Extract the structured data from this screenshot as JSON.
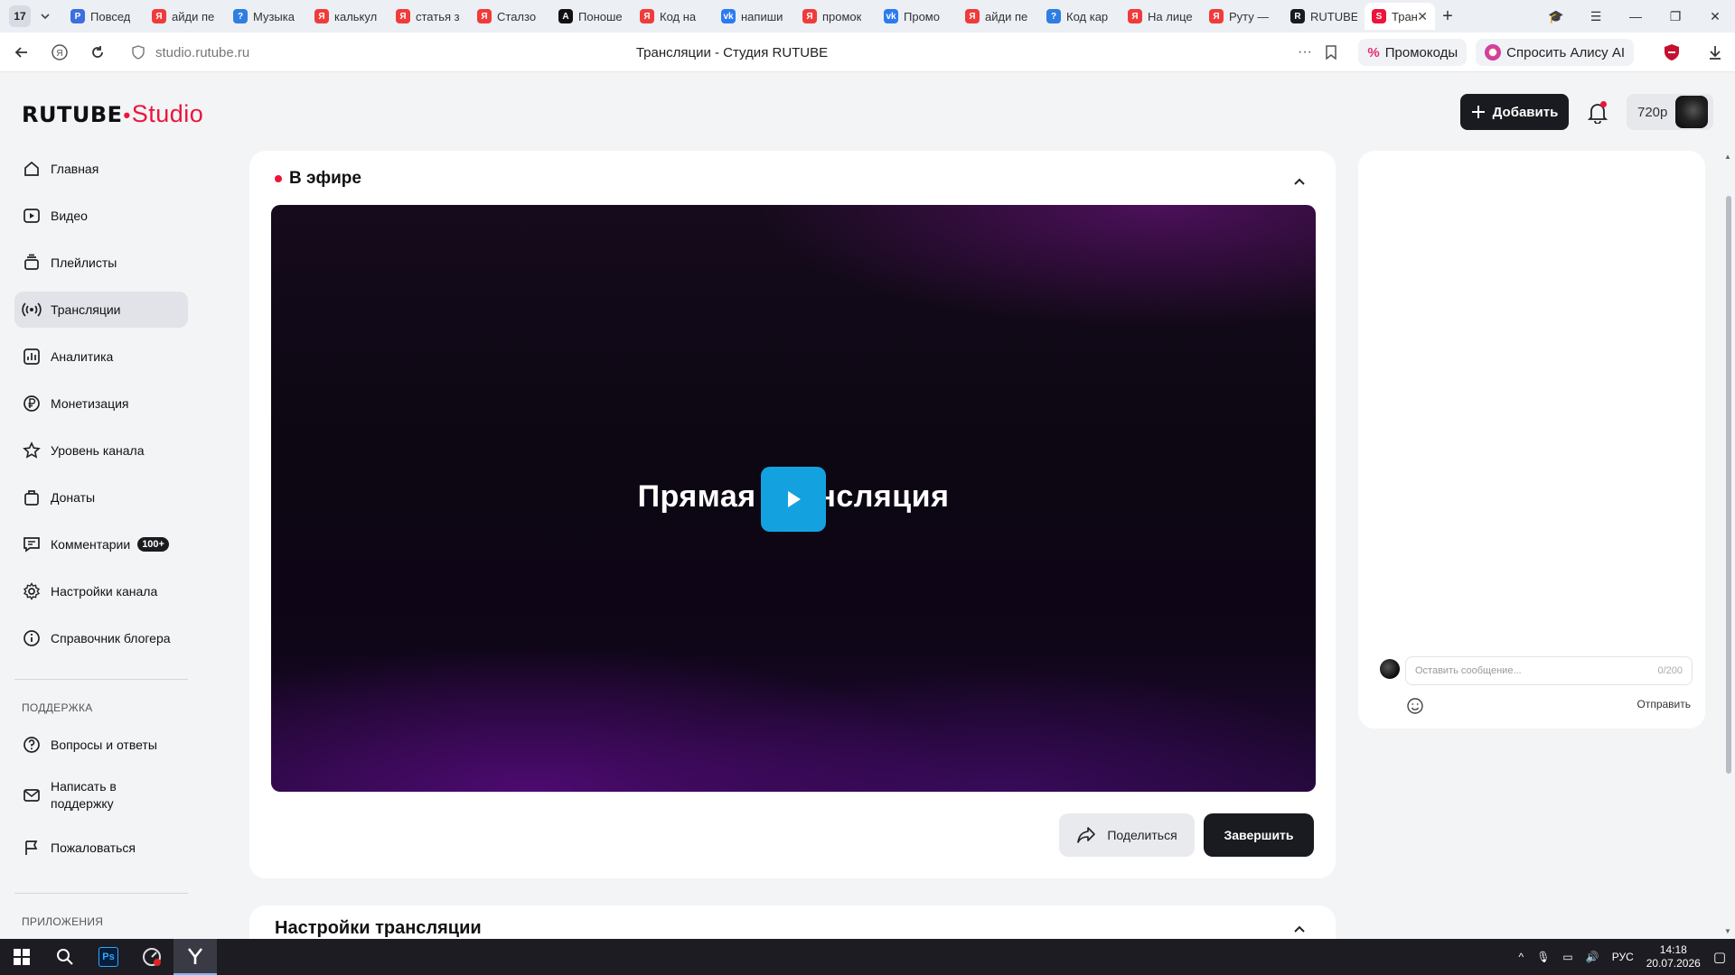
{
  "browser": {
    "tab_counter": "17",
    "tabs": [
      {
        "label": "Повсед",
        "color": "#3b6fe0",
        "glyph": "P"
      },
      {
        "label": "айди пе",
        "color": "#f03b3b",
        "glyph": "Я"
      },
      {
        "label": "Музыка",
        "color": "#2f7de1",
        "glyph": "?"
      },
      {
        "label": "калькул",
        "color": "#f03b3b",
        "glyph": "Я"
      },
      {
        "label": "статья з",
        "color": "#f03b3b",
        "glyph": "Я"
      },
      {
        "label": "Сталзо",
        "color": "#f03b3b",
        "glyph": "Я"
      },
      {
        "label": "Поноше",
        "color": "#111111",
        "glyph": "A"
      },
      {
        "label": "Код на",
        "color": "#f03b3b",
        "glyph": "Я"
      },
      {
        "label": "напиши",
        "color": "#2b7bf0",
        "glyph": "vk"
      },
      {
        "label": "промок",
        "color": "#f03b3b",
        "glyph": "Я"
      },
      {
        "label": "Промо",
        "color": "#2b7bf0",
        "glyph": "vk"
      },
      {
        "label": "айди пе",
        "color": "#f03b3b",
        "glyph": "Я"
      },
      {
        "label": "Код кар",
        "color": "#2f7de1",
        "glyph": "?"
      },
      {
        "label": "На лице",
        "color": "#f03b3b",
        "glyph": "Я"
      },
      {
        "label": "Руту —",
        "color": "#f03b3b",
        "glyph": "Я"
      },
      {
        "label": "RUTUBE",
        "color": "#1a1b20",
        "glyph": "R"
      }
    ],
    "active_tab": {
      "label": "Тран",
      "color": "#ed143b",
      "glyph": "S"
    },
    "url": "studio.rutube.ru",
    "page_title": "Трансляции - Студия RUTUBE",
    "promo_label": "Промокоды",
    "alice_label": "Спросить Алису AI"
  },
  "header": {
    "logo_rutube": "RUTUBE",
    "logo_studio": "Studio",
    "add_label": "Добавить",
    "quality": "720p"
  },
  "sidebar": {
    "items": [
      {
        "label": "Главная",
        "icon": "home-icon"
      },
      {
        "label": "Видео",
        "icon": "video-icon"
      },
      {
        "label": "Плейлисты",
        "icon": "playlist-icon"
      },
      {
        "label": "Трансляции",
        "icon": "broadcast-icon"
      },
      {
        "label": "Аналитика",
        "icon": "analytics-icon"
      },
      {
        "label": "Монетизация",
        "icon": "ruble-icon"
      },
      {
        "label": "Уровень канала",
        "icon": "star-icon"
      },
      {
        "label": "Донаты",
        "icon": "donate-icon"
      },
      {
        "label": "Комментарии",
        "icon": "comment-icon",
        "badge": "100+"
      },
      {
        "label": "Настройки канала",
        "icon": "gear-icon"
      },
      {
        "label": "Справочник блогера",
        "icon": "info-icon"
      }
    ],
    "support_heading": "ПОДДЕРЖКА",
    "support_items": [
      {
        "label": "Вопросы и ответы",
        "icon": "question-icon"
      },
      {
        "label": "Написать в поддержку",
        "icon": "mail-icon"
      },
      {
        "label": "Пожаловаться",
        "icon": "flag-icon"
      }
    ],
    "apps_heading": "ПРИЛОЖЕНИЯ"
  },
  "live": {
    "title": "В эфире",
    "player_text": "Прямая трансляция",
    "share_label": "Поделиться",
    "finish_label": "Завершить"
  },
  "settings": {
    "title": "Настройки трансляции"
  },
  "chat": {
    "placeholder": "Оставить сообщение...",
    "counter": "0/200",
    "send_label": "Отправить"
  },
  "taskbar": {
    "lang": "РУС",
    "time": "14:18",
    "date": "20.07.2026"
  },
  "colors": {
    "brand_red": "#ed143b",
    "play_blue": "#14a1e0",
    "dark_button": "#1a1b20"
  }
}
